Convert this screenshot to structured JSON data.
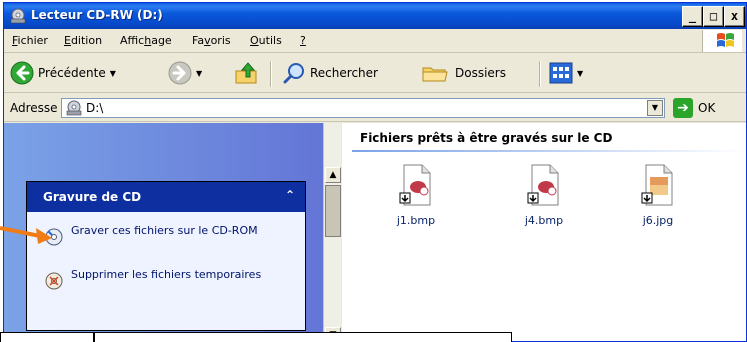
{
  "window": {
    "title": "Lecteur CD-RW (D:)",
    "controls": {
      "minimize": "_",
      "maximize": "□",
      "close": "x"
    }
  },
  "menubar": {
    "items": [
      {
        "label": "Fichier",
        "accel": "F"
      },
      {
        "label": "Edition",
        "accel": "E"
      },
      {
        "label": "Affichage",
        "accel": "h"
      },
      {
        "label": "Favoris",
        "accel": "v"
      },
      {
        "label": "Outils",
        "accel": "O"
      },
      {
        "label": "?",
        "accel": "?"
      }
    ]
  },
  "toolbar": {
    "back_label": "Précédente",
    "search_label": "Rechercher",
    "folders_label": "Dossiers"
  },
  "address": {
    "label": "Adresse",
    "value": "D:\\",
    "go_label": "OK"
  },
  "tasks": {
    "header": "Gravure de CD",
    "items": [
      {
        "label": "Graver ces fichiers sur le CD-ROM",
        "icon": "cd-burn-icon"
      },
      {
        "label": "Supprimer les fichiers temporaires",
        "icon": "delete-temp-icon"
      }
    ]
  },
  "files": {
    "section_title": "Fichiers prêts à être gravés sur le CD",
    "items": [
      {
        "name": "j1.bmp",
        "type": "bmp"
      },
      {
        "name": "j4.bmp",
        "type": "bmp"
      },
      {
        "name": "j6.jpg",
        "type": "jpg"
      }
    ]
  },
  "colors": {
    "titlebar": "#0a59dc",
    "task_header": "#0e2fa0",
    "left_pane": "#7ba2e7",
    "pointer": "#f07c16"
  }
}
